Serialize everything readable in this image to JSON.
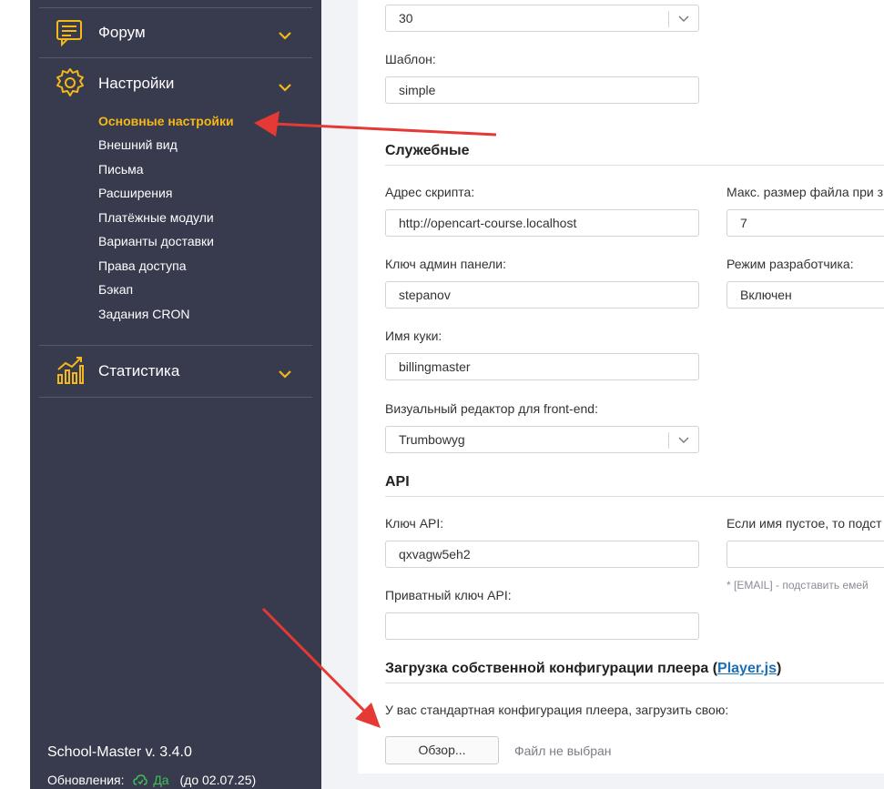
{
  "sidebar": {
    "groups": [
      {
        "label": "Форум",
        "icon": "forum-icon",
        "chevron": "chevron-down-icon"
      },
      {
        "label": "Настройки",
        "icon": "gear-icon",
        "chevron": "chevron-down-icon"
      },
      {
        "label": "Статистика",
        "icon": "chart-icon",
        "chevron": "chevron-down-icon"
      }
    ],
    "settings_items": [
      {
        "label": "Основные настройки",
        "active": true
      },
      {
        "label": "Внешний вид"
      },
      {
        "label": "Письма"
      },
      {
        "label": "Расширения"
      },
      {
        "label": "Платёжные модули"
      },
      {
        "label": "Варианты доставки"
      },
      {
        "label": "Права доступа"
      },
      {
        "label": "Бэкап"
      },
      {
        "label": "Задания CRON"
      }
    ],
    "version": "School-Master v. 3.4.0",
    "updates_label": "Обновления:",
    "updates_value": "Да",
    "updates_until": "(до 02.07.25)"
  },
  "form": {
    "top_select_value": "30",
    "template_label": "Шаблон:",
    "template_value": "simple",
    "service_heading": "Служебные",
    "script_url_label": "Адрес скрипта:",
    "script_url_value": "http://opencart-course.localhost",
    "max_file_label": "Макс. размер файла при з",
    "max_file_value": "7",
    "admin_key_label": "Ключ админ панели:",
    "admin_key_value": "stepanov",
    "dev_mode_label": "Режим разработчика:",
    "dev_mode_value": "Включен",
    "cookie_label": "Имя куки:",
    "cookie_value": "billingmaster",
    "editor_label": "Визуальный редактор для front-end:",
    "editor_value": "Trumbowyg",
    "api_heading": "API",
    "api_key_label": "Ключ API:",
    "api_key_value": "qxvagw5eh2",
    "empty_name_label": "Если имя пустое, то подст",
    "empty_name_value": "",
    "email_hint": "* [EMAIL] - подставить емей",
    "private_key_label": "Приватный ключ API:",
    "private_key_value": "",
    "player_heading_prefix": "Загрузка собственной конфигурации плеера (",
    "player_link": "Player.js",
    "player_heading_suffix": ")",
    "player_text": "У вас стандартная конфигурация плеера, загрузить свою:",
    "browse_button": "Обзор...",
    "file_status": "Файл не выбран"
  },
  "colors": {
    "sidebar_bg": "#383a4d",
    "accent_yellow": "#f5b819",
    "annotation_red": "#e53935",
    "link_blue": "#1a6fb8",
    "success_green": "#3fbf5a"
  }
}
